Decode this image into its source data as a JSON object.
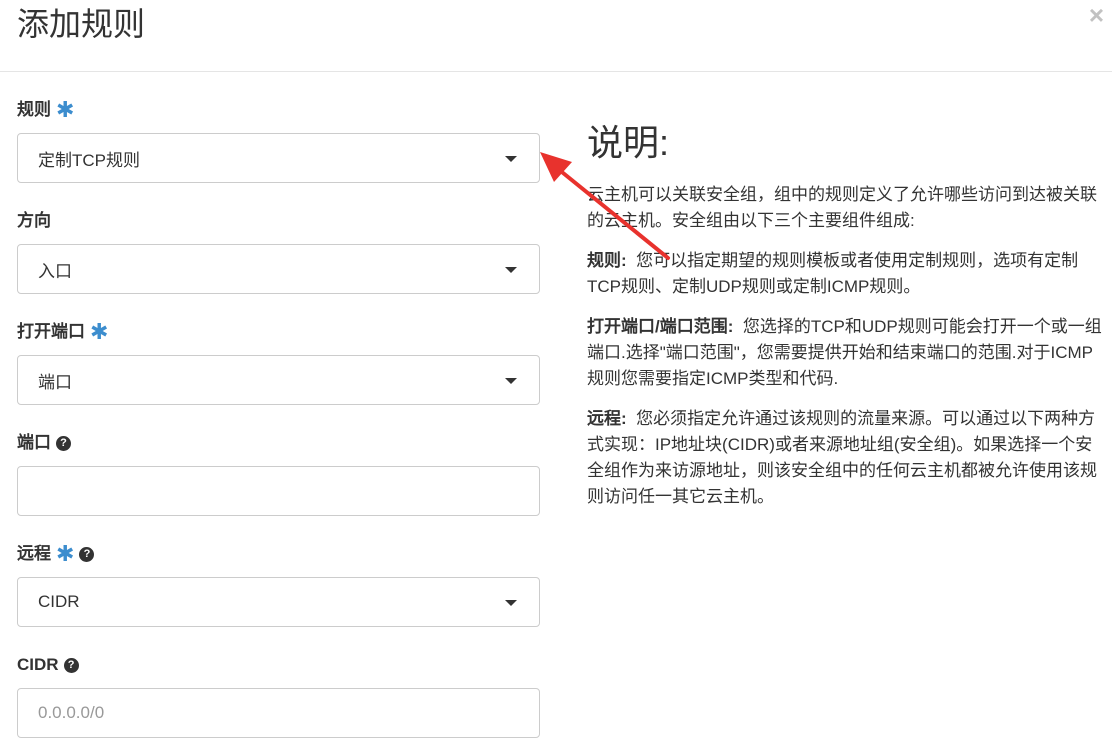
{
  "dialog": {
    "title": "添加规则",
    "close_label": "×"
  },
  "colors": {
    "required": "#3c8dce",
    "annotation_arrow": "#e8322d"
  },
  "icons": {
    "required": "asterisk-icon",
    "help": "question-circle-icon",
    "dropdown": "caret-down-icon",
    "close": "close-icon"
  },
  "form": {
    "rule": {
      "label": "规则",
      "required_mark": "✱",
      "value": "定制TCP规则"
    },
    "direction": {
      "label": "方向",
      "value": "入口"
    },
    "open_port": {
      "label": "打开端口",
      "required_mark": "✱",
      "value": "端口"
    },
    "port": {
      "label": "端口",
      "help_mark": "?",
      "value": ""
    },
    "remote": {
      "label": "远程",
      "required_mark": "✱",
      "help_mark": "?",
      "value": "CIDR"
    },
    "cidr": {
      "label": "CIDR",
      "help_mark": "?",
      "placeholder": "0.0.0.0/0"
    }
  },
  "info": {
    "heading": "说明:",
    "intro": "云主机可以关联安全组，组中的规则定义了允许哪些访问到达被关联的云主机。安全组由以下三个主要组件组成:",
    "rule_term": "规则:",
    "rule_text": "您可以指定期望的规则模板或者使用定制规则，选项有定制TCP规则、定制UDP规则或定制ICMP规则。",
    "port_term": "打开端口/端口范围:",
    "port_text": "您选择的TCP和UDP规则可能会打开一个或一组端口.选择\"端口范围\"，您需要提供开始和结束端口的范围.对于ICMP规则您需要指定ICMP类型和代码.",
    "remote_term": "远程:",
    "remote_text": "您必须指定允许通过该规则的流量来源。可以通过以下两种方式实现：IP地址块(CIDR)或者来源地址组(安全组)。如果选择一个安全组作为来访源地址，则该安全组中的任何云主机都被允许使用该规则访问任一其它云主机。"
  }
}
